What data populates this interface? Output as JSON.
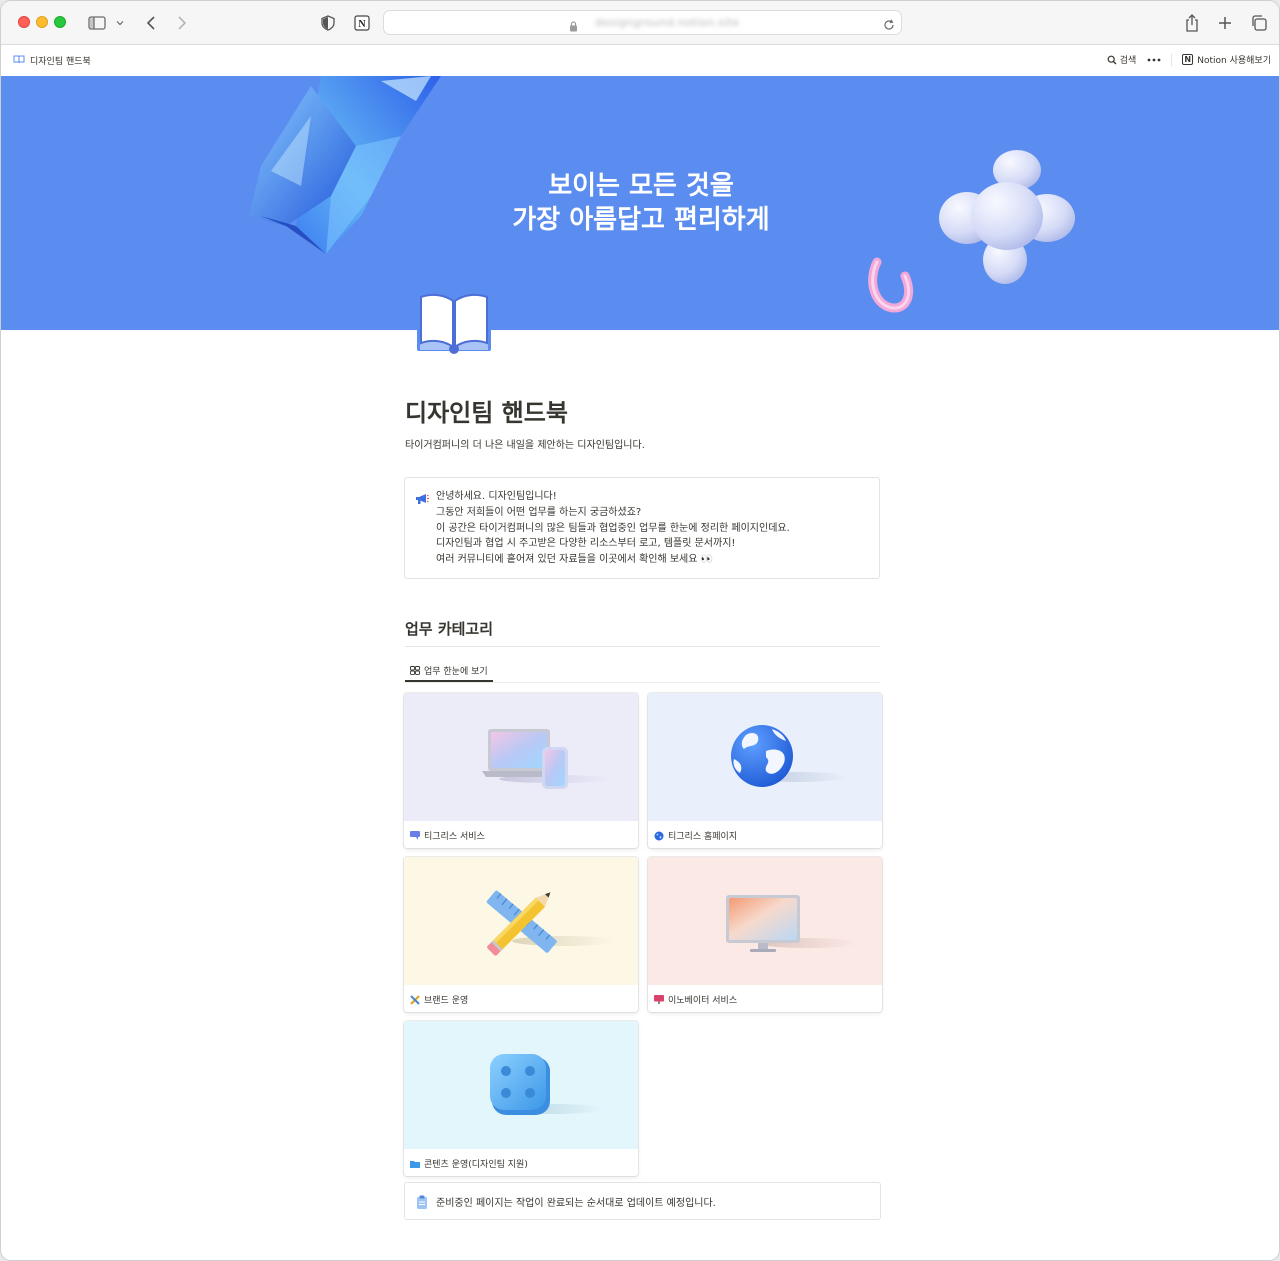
{
  "browser": {
    "url": "designground.notion.site",
    "icons": [
      "sidebar-icon",
      "chevron-down-icon",
      "back-icon",
      "forward-icon",
      "shield-icon",
      "notion-extension-icon",
      "lock-icon",
      "reload-icon",
      "share-icon",
      "new-tab-icon",
      "tabs-overview-icon"
    ]
  },
  "topbar": {
    "breadcrumb": "디자인팀 핸드북",
    "search_label": "검색",
    "more_icon": "ellipsis-icon",
    "try_notion": "Notion 사용해보기"
  },
  "cover": {
    "line1": "보이는 모든 것을",
    "line2": "가장 아름답고 편리하게",
    "background": "#5b8cf0"
  },
  "page": {
    "icon": "open-book-icon",
    "title": "디자인팀 핸드북",
    "subtitle": "타이거컴퍼니의 더 나은 내일을 제안하는 디자인팀입니다."
  },
  "callout": {
    "icon": "megaphone-icon",
    "lines": [
      "안녕하세요. 디자인팀입니다!",
      "그동안 저희들이 어떤 업무를 하는지 궁금하셨죠?",
      "이 공간은 타이거컴퍼니의 많은 팀들과 협업중인 업무를 한눈에 정리한 페이지인데요.",
      "디자인팀과 협업 시 주고받은 다양한 리소스부터 로고, 템플릿 문서까지!",
      "여러 커뮤니티에 흩어져 있던 자료들을 이곳에서 확인해 보세요 👀"
    ]
  },
  "section": {
    "heading": "업무 카테고리",
    "view_tab": "업무 한눈에 보기"
  },
  "cards": [
    {
      "label": "티그리스 서비스",
      "icon": "chat-icon",
      "bg": "#ecebf8"
    },
    {
      "label": "티그리스 홈페이지",
      "icon": "globe-icon",
      "bg": "#e9f0fb"
    },
    {
      "label": "브랜드 운영",
      "icon": "pencil-ruler-icon",
      "bg": "#fdf8e6"
    },
    {
      "label": "이노베이터 서비스",
      "icon": "monitor-icon",
      "bg": "#fbe9e6"
    },
    {
      "label": "콘텐츠 운영(디자인팀 지원)",
      "icon": "folder-icon",
      "bg": "#e3f6fc"
    }
  ],
  "footer_callout": {
    "icon": "clipboard-icon",
    "text": "준비중인 페이지는 작업이 완료되는 순서대로 업데이트 예정입니다."
  }
}
